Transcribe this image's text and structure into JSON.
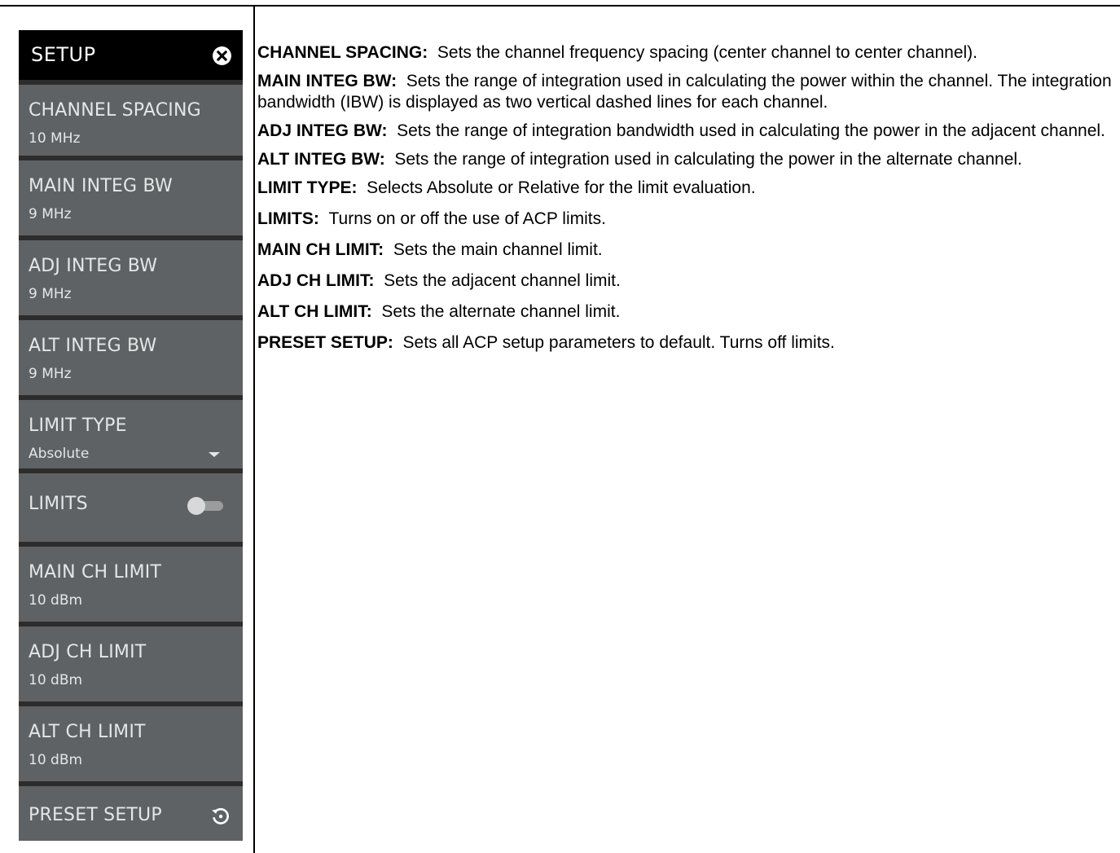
{
  "menu": {
    "title": "SETUP",
    "items": [
      {
        "label": "CHANNEL SPACING",
        "value": "10 MHz"
      },
      {
        "label": "MAIN INTEG BW",
        "value": "9 MHz"
      },
      {
        "label": "ADJ INTEG BW",
        "value": "9 MHz"
      },
      {
        "label": "ALT INTEG BW",
        "value": "9 MHz"
      },
      {
        "label": "LIMIT TYPE",
        "value": "Absolute"
      },
      {
        "label": "LIMITS",
        "toggle_on": false
      },
      {
        "label": "MAIN CH LIMIT",
        "value": "10 dBm"
      },
      {
        "label": "ADJ CH LIMIT",
        "value": "10 dBm"
      },
      {
        "label": "ALT CH LIMIT",
        "value": "10 dBm"
      },
      {
        "label": "PRESET SETUP"
      }
    ]
  },
  "descriptions": [
    {
      "term": "CHANNEL SPACING:",
      "text": "Sets the channel frequency spacing (center channel to center channel)."
    },
    {
      "term": "MAIN INTEG BW:",
      "text": "Sets the range of integration used in calculating the power within the channel. The integration bandwidth (IBW) is displayed as two vertical dashed lines for each channel."
    },
    {
      "term": "ADJ INTEG BW:",
      "text": "Sets the range of integration bandwidth used in calculating the power in the adjacent channel."
    },
    {
      "term": "ALT INTEG BW:",
      "text": "Sets the range of integration used in calculating the power in the alternate channel."
    },
    {
      "term": "LIMIT TYPE:",
      "text": "Selects Absolute or Relative for the limit evaluation."
    },
    {
      "term": "LIMITS:",
      "text": "Turns on or off the use of ACP limits."
    },
    {
      "term": "MAIN CH LIMIT:",
      "text": "Sets the main channel limit."
    },
    {
      "term": "ADJ CH LIMIT:",
      "text": "Sets the adjacent channel limit."
    },
    {
      "term": "ALT CH LIMIT:",
      "text": "Sets the alternate channel limit."
    },
    {
      "term": "PRESET SETUP:",
      "text": "Sets all ACP setup parameters to default. Turns off limits."
    }
  ]
}
